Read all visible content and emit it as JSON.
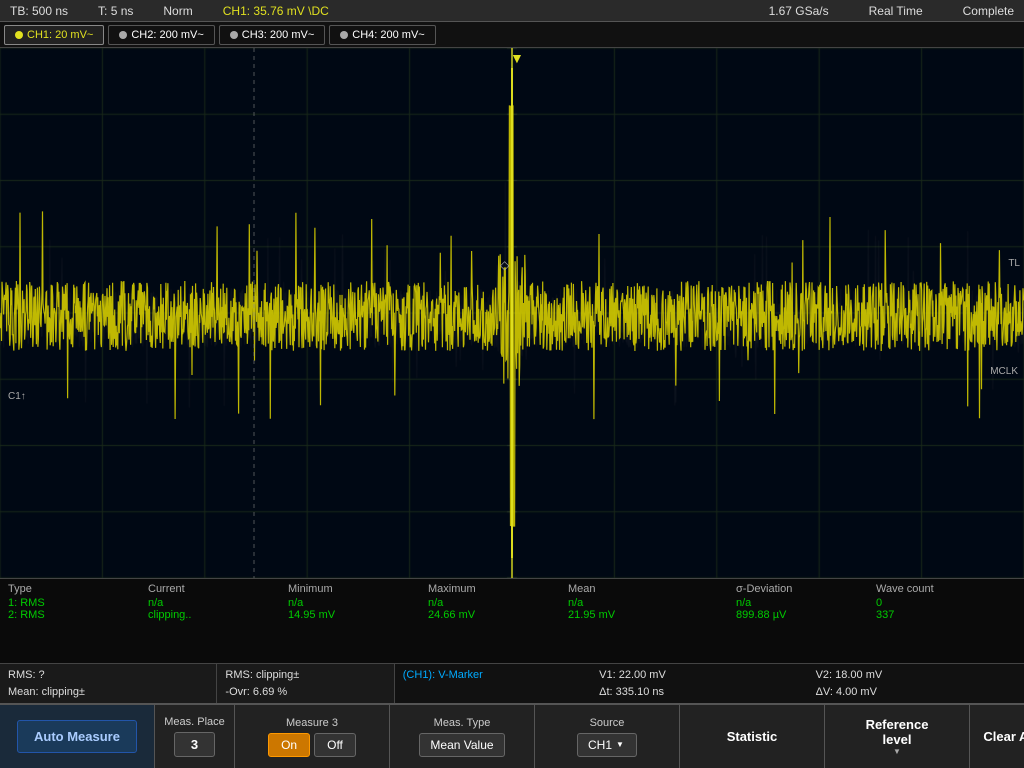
{
  "statusBar": {
    "tb": "TB: 500 ns",
    "t": "T: 5 ns",
    "norm": "Norm",
    "channel": "CH1: 35.76 mV",
    "dcSymbol": "\\DC",
    "sampleRate": "1.67 GSa/s",
    "timeMode": "Real Time",
    "status": "Complete"
  },
  "channelTabs": [
    {
      "label": "CH1: 20 mV~",
      "color": "#e0e020",
      "active": true
    },
    {
      "label": "CH2: 200 mV~",
      "color": "#aaa",
      "active": false
    },
    {
      "label": "CH3: 200 mV~",
      "color": "#aaa",
      "active": false
    },
    {
      "label": "CH4: 200 mV~",
      "color": "#aaa",
      "active": false
    }
  ],
  "scopeLabels": {
    "c1": "C1↑",
    "mclk": "MCLK",
    "triggerArrow": "▼",
    "tlMarker": "TL",
    "cursorDiamond": "◇"
  },
  "measureTable": {
    "headers": [
      "Type",
      "Current",
      "Minimum",
      "Maximum",
      "Mean",
      "",
      "σ-Deviation",
      "Wave count"
    ],
    "rows": [
      {
        "type": "1: RMS",
        "current": "n/a",
        "minimum": "n/a",
        "maximum": "n/a",
        "mean": "n/a",
        "blank": "",
        "sigma": "n/a",
        "waveCount": "0"
      },
      {
        "type": "2: RMS",
        "current": "clipping..",
        "minimum": "14.95 mV",
        "maximum": "24.66 mV",
        "mean": "21.95 mV",
        "blank": "",
        "sigma": "899.88 µV",
        "waveCount": "337"
      }
    ]
  },
  "statusMessages": {
    "line1left": "RMS: ?",
    "line2left": "Mean: clipping±",
    "line1right": "RMS: clipping±",
    "line2right": "-Ovr: 6.69 %",
    "ch1marker": "(CH1): V-Marker",
    "v1": "V1: 22.00 mV",
    "v2": "V2: 18.00 mV",
    "deltaT": "Δt: 335.10 ns",
    "deltaV": "ΔV: 4.00 mV"
  },
  "bottomButtons": {
    "autoMeasure": "Auto Measure",
    "measPlace": "Meas. Place",
    "measPlaceVal": "3",
    "measure3": "Measure 3",
    "onLabel": "On",
    "offLabel": "Off",
    "measType": "Meas. Type",
    "meanValue": "Mean Value",
    "source": "Source",
    "ch1": "CH1",
    "statistic": "Statistic",
    "referenceLevel": "Reference\nlevel",
    "clearAll": "Clear All"
  }
}
